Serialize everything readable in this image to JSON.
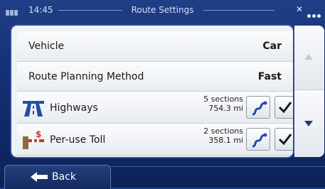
{
  "status_bar": {
    "time": "14:45",
    "title": "Route Settings",
    "right_symbol": "✕"
  },
  "settings": {
    "vehicle": {
      "label": "Vehicle",
      "value": "Car"
    },
    "route_planning": {
      "label": "Route Planning Method",
      "value": "Fast"
    }
  },
  "road_types": [
    {
      "label": "Highways",
      "sections": "5 sections",
      "distance": "754.3 mi",
      "icon": "highway-icon",
      "checked": true
    },
    {
      "label": "Per-use Toll",
      "sections": "2 sections",
      "distance": "358.1 mi",
      "icon": "toll-icon",
      "checked": true
    }
  ],
  "bottom": {
    "back_label": "Back"
  },
  "colors": {
    "background": "#143074",
    "panel": "#eef1f5",
    "accent": "#1d3b84",
    "route_icon": "#1f4fa8"
  }
}
